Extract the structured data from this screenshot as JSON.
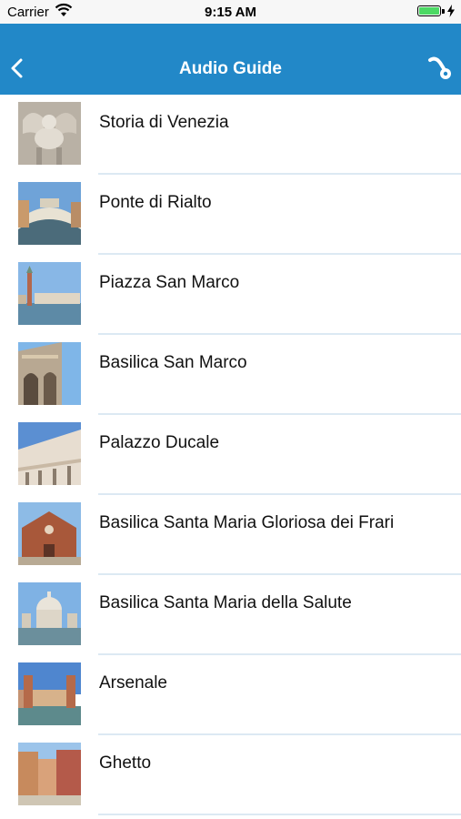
{
  "status_bar": {
    "carrier": "Carrier",
    "time": "9:15 AM",
    "battery_color": "#4cd964"
  },
  "nav": {
    "title": "Audio Guide",
    "color": "#2288c8",
    "back_icon": "chevron-left-icon",
    "right_icon": "headset-icon"
  },
  "list": {
    "items": [
      {
        "label": "Storia di Venezia",
        "thumb": "winged-lion-statue"
      },
      {
        "label": "Ponte di Rialto",
        "thumb": "rialto-bridge"
      },
      {
        "label": "Piazza San Marco",
        "thumb": "campanile-lagoon"
      },
      {
        "label": "Basilica San Marco",
        "thumb": "basilica-arches"
      },
      {
        "label": "Palazzo Ducale",
        "thumb": "doges-palace"
      },
      {
        "label": "Basilica Santa Maria Gloriosa dei Frari",
        "thumb": "frari-church"
      },
      {
        "label": "Basilica Santa Maria della Salute",
        "thumb": "salute-dome"
      },
      {
        "label": "Arsenale",
        "thumb": "arsenale-gate"
      },
      {
        "label": "Ghetto",
        "thumb": "ghetto-buildings"
      }
    ]
  }
}
